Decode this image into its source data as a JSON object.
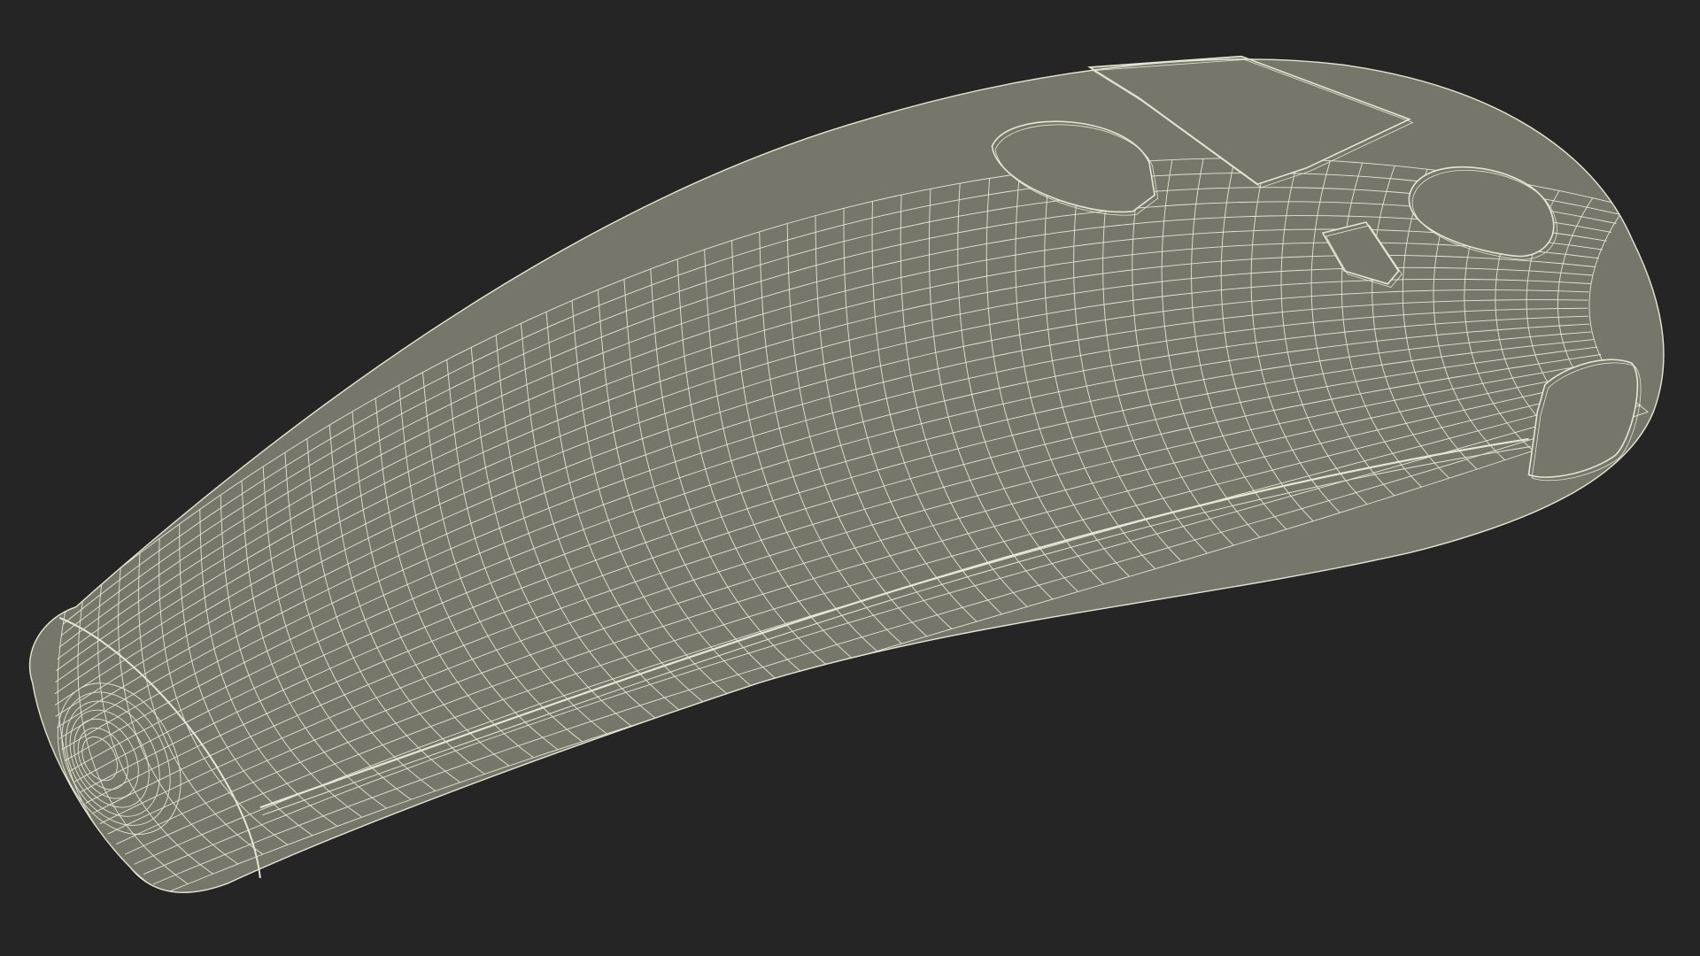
{
  "scene": {
    "background_color": "#252525",
    "model_fill_color": "#76766a",
    "wire_color": "#e6e6d2",
    "subject": "wireframe-remote-control-model",
    "render_mode": "wireframe-over-shaded"
  }
}
